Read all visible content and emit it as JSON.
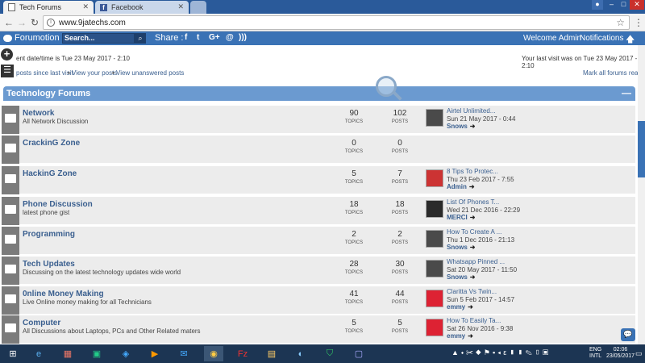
{
  "browser": {
    "tabs": [
      {
        "title": "Tech Forums",
        "active": true
      },
      {
        "title": "Facebook",
        "active": false
      }
    ],
    "url": "www.9jatechs.com"
  },
  "topnav": {
    "brand": "Forumotion",
    "search_placeholder": "Search...",
    "share_label": "Share :",
    "share_icons": [
      "f",
      "t",
      "G+",
      "@",
      "rss"
    ],
    "welcome": "Welcome Admin",
    "notifications": "Notifications"
  },
  "info": {
    "current_time": "ent date/time is Tue 23 May 2017 - 2:10",
    "last_visit": "Your last visit was on Tue 23 May 2017 - 2:10",
    "links": [
      "posts since last visit",
      "View your posts",
      "View unanswered posts"
    ],
    "mark_read": "Mark all forums read"
  },
  "category": {
    "title": "Technology Forums"
  },
  "forums": [
    {
      "name": "Network",
      "desc": "All Network Discussion",
      "topics": "90",
      "posts": "102",
      "last_title": "Airtel Unlimited...",
      "last_date": "Sun 21 May 2017 - 0:44",
      "last_user": "Snows",
      "avatar_color": "#4a4a4a"
    },
    {
      "name": "CrackinG Zone",
      "desc": "",
      "topics": "0",
      "posts": "0",
      "last_title": "",
      "last_date": "",
      "last_user": "",
      "avatar_color": ""
    },
    {
      "name": "HackinG Zone",
      "desc": "",
      "topics": "5",
      "posts": "7",
      "last_title": "8 Tips To Protec...",
      "last_date": "Thu 23 Feb 2017 - 7:55",
      "last_user": "Admin",
      "avatar_color": "#c33"
    },
    {
      "name": "Phone Discussion",
      "desc": "latest phone gist",
      "topics": "18",
      "posts": "18",
      "last_title": "List Of Phones T...",
      "last_date": "Wed 21 Dec 2016 - 22:29",
      "last_user": "MERCI",
      "avatar_color": "#2a2a2a"
    },
    {
      "name": "Programming",
      "desc": "",
      "topics": "2",
      "posts": "2",
      "last_title": "How To Create A ...",
      "last_date": "Thu 1 Dec 2016 - 21:13",
      "last_user": "Snows",
      "avatar_color": "#4a4a4a"
    },
    {
      "name": "Tech Updates",
      "desc": "Discussing on the latest technology updates wide world",
      "topics": "28",
      "posts": "30",
      "last_title": "Whatsapp Pinned ...",
      "last_date": "Sat 20 May 2017 - 11:50",
      "last_user": "Snows",
      "avatar_color": "#4a4a4a"
    },
    {
      "name": "0nline Money Making",
      "desc": "Live Online money making for all Technicians",
      "topics": "41",
      "posts": "44",
      "last_title": "Claritta Vs Twin...",
      "last_date": "Sun 5 Feb 2017 - 14:57",
      "last_user": "emmy",
      "avatar_color": "#d23"
    },
    {
      "name": "Computer",
      "desc": "All Discussions about Laptops, PCs and Other Related maters",
      "topics": "5",
      "posts": "5",
      "last_title": "How To Easily Ta...",
      "last_date": "Sat 26 Nov 2016 - 9:38",
      "last_user": "emmy",
      "avatar_color": "#d23"
    }
  ],
  "labels": {
    "topics": "TOPICS",
    "posts": "POSTS"
  },
  "taskbar": {
    "lang": [
      "ENG",
      "INTL"
    ],
    "time": "02:06",
    "date": "23/05/2017"
  }
}
